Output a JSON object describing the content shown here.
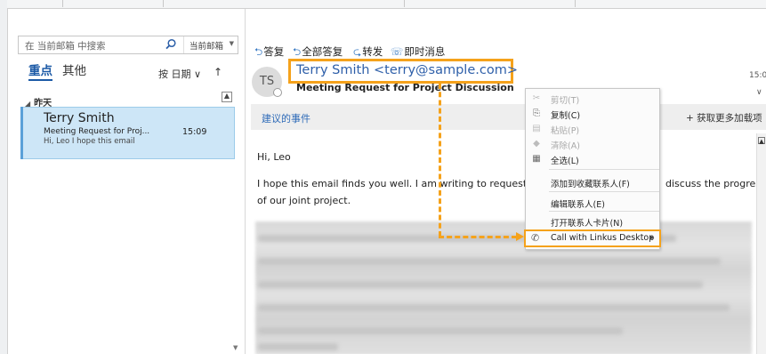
{
  "search": {
    "placeholder": "在 当前邮箱 中搜索",
    "scope_label": "当前邮箱"
  },
  "tabs": {
    "focused": "重点",
    "other": "其他"
  },
  "sort": {
    "label": "按 日期 ∨",
    "direction": "↑"
  },
  "group": {
    "label": "昨天"
  },
  "mail_item": {
    "sender": "Terry Smith",
    "subject": "Meeting Request for Proj...",
    "time": "15:09",
    "preview": "Hi, Leo  I hope this email"
  },
  "actions": {
    "reply": "答复",
    "reply_all": "全部答复",
    "forward": "转发",
    "im": "即时消息"
  },
  "message": {
    "avatar_initials": "TS",
    "from": "Terry Smith <terry@sample.com>",
    "subject": "Meeting Request for Project Discussion",
    "time": "15:0",
    "suggested_events": "建议的事件",
    "get_addins": "+ 获取更多加载项",
    "greeting": "Hi, Leo",
    "line1_start": "I hope this email finds you well. I am writing to request a meet",
    "line1_end": "discuss the progress",
    "line2": "of our joint project."
  },
  "context_menu": {
    "items": [
      {
        "label": "剪切(T)",
        "icon": "scissors-icon",
        "disabled": true
      },
      {
        "label": "复制(C)",
        "icon": "copy-icon",
        "disabled": false
      },
      {
        "label": "粘贴(P)",
        "icon": "paste-icon",
        "disabled": true
      },
      {
        "label": "清除(A)",
        "icon": "eraser-icon",
        "disabled": true
      },
      {
        "label": "全选(L)",
        "icon": "select-all-icon",
        "disabled": false
      },
      {
        "label": "添加到收藏联系人(F)",
        "icon": "",
        "disabled": false
      },
      {
        "label": "编辑联系人(E)",
        "icon": "",
        "disabled": false
      },
      {
        "label": "打开联系人卡片(N)",
        "icon": "",
        "disabled": false
      }
    ],
    "call_item": "Call with Linkus Desktop"
  },
  "colors": {
    "highlight": "#f5a21b",
    "accent": "#1c5aa6",
    "selected_row": "#cde6f7"
  }
}
